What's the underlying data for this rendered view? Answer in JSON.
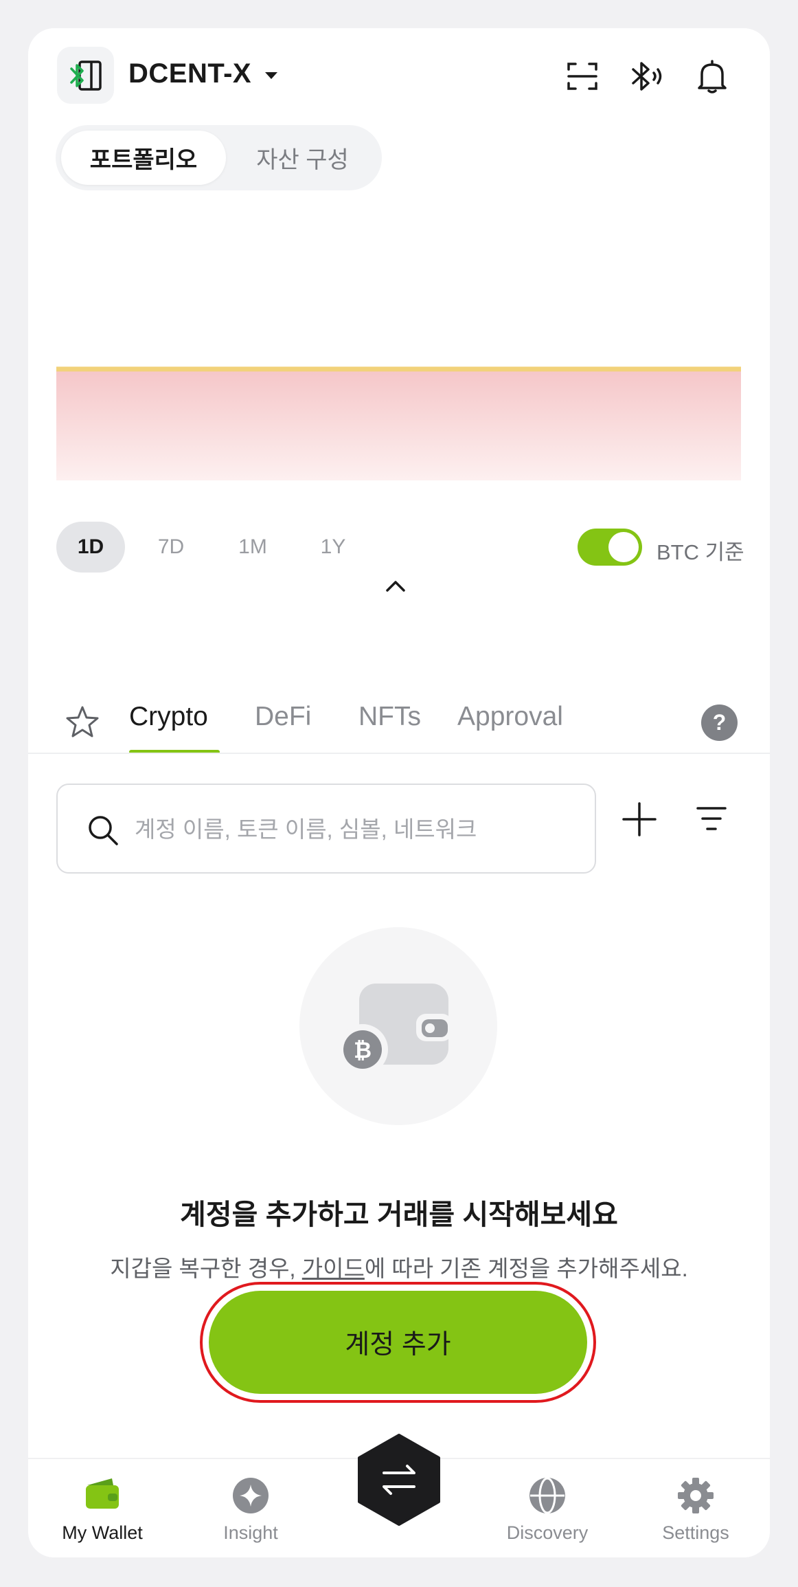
{
  "header": {
    "device_name": "DCENT-X",
    "icons": [
      "device-bluetooth-icon",
      "scan-icon",
      "bluetooth-icon",
      "bell-icon"
    ]
  },
  "segment": {
    "active": "포트폴리오",
    "inactive": "자산 구성"
  },
  "periods": [
    "1D",
    "7D",
    "1M",
    "1Y"
  ],
  "toggle": {
    "label": "BTC 기준",
    "on": true
  },
  "tabs": [
    "Crypto",
    "DeFi",
    "NFTs",
    "Approval"
  ],
  "search": {
    "placeholder": "계정 이름, 토큰 이름, 심볼, 네트워크",
    "value": ""
  },
  "empty": {
    "coin_symbol": "₿",
    "title": "계정을 추가하고 거래를 시작해보세요",
    "desc_before": "지갑을 복구한 경우, ",
    "desc_link": "가이드",
    "desc_after": "에 따라 기존 계정을 추가해주세요.",
    "button": "계정 추가"
  },
  "nav": {
    "my_wallet": "My Wallet",
    "insight": "Insight",
    "discovery": "Discovery",
    "settings": "Settings"
  },
  "colors": {
    "accent": "#84c414",
    "highlight": "#e0191e",
    "chart_line": "#f2d27a",
    "chart_fill": "#f5c9cb"
  }
}
